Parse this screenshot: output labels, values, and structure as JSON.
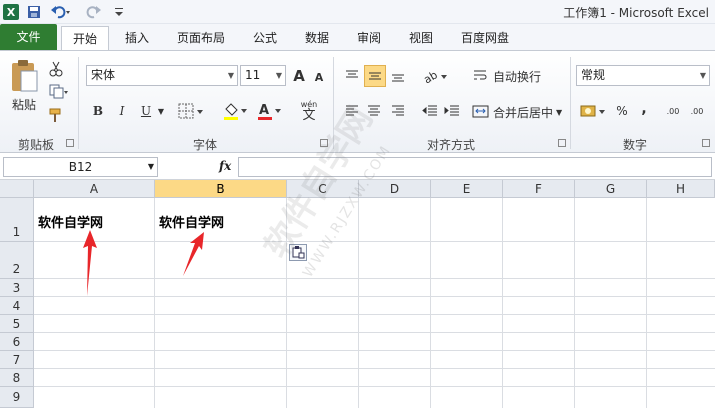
{
  "window": {
    "title": "工作簿1 - Microsoft Excel"
  },
  "quick_access": {
    "app_icon": "X",
    "save": "save-icon",
    "undo": "undo-icon",
    "redo": "redo-icon",
    "customize": "dropdown-icon"
  },
  "tabs": [
    {
      "label": "文件"
    },
    {
      "label": "开始"
    },
    {
      "label": "插入"
    },
    {
      "label": "页面布局"
    },
    {
      "label": "公式"
    },
    {
      "label": "数据"
    },
    {
      "label": "审阅"
    },
    {
      "label": "视图"
    },
    {
      "label": "百度网盘"
    }
  ],
  "ribbon": {
    "clipboard": {
      "paste": "粘贴",
      "group": "剪贴板"
    },
    "font": {
      "name": "宋体",
      "size": "11",
      "grow": "A",
      "shrink": "A",
      "bold": "B",
      "italic": "I",
      "underline": "U",
      "wen": "wén",
      "wen_char": "文",
      "group": "字体"
    },
    "alignment": {
      "wrap": "自动换行",
      "merge": "合并后居中",
      "group": "对齐方式"
    },
    "number": {
      "format": "常规",
      "percent": "%",
      "comma": ",",
      "inc": ".00",
      "dec": ".00",
      "group": "数字"
    }
  },
  "formula": {
    "cell_ref": "B12",
    "fx": "fx",
    "value": ""
  },
  "columns": [
    "A",
    "B",
    "C",
    "D",
    "E",
    "F",
    "G",
    "H"
  ],
  "rows": [
    "1",
    "2",
    "3",
    "4",
    "5",
    "6",
    "7",
    "8",
    "9"
  ],
  "cells": {
    "A1": "软件自学网",
    "B1": "软件自学网"
  },
  "watermark": {
    "text": "软件自学网",
    "url": "WWW.RJZXW.COM"
  },
  "colors": {
    "file_tab": "#2f7d32",
    "selected_header": "#fcd986",
    "arrow": "#e8262a"
  }
}
